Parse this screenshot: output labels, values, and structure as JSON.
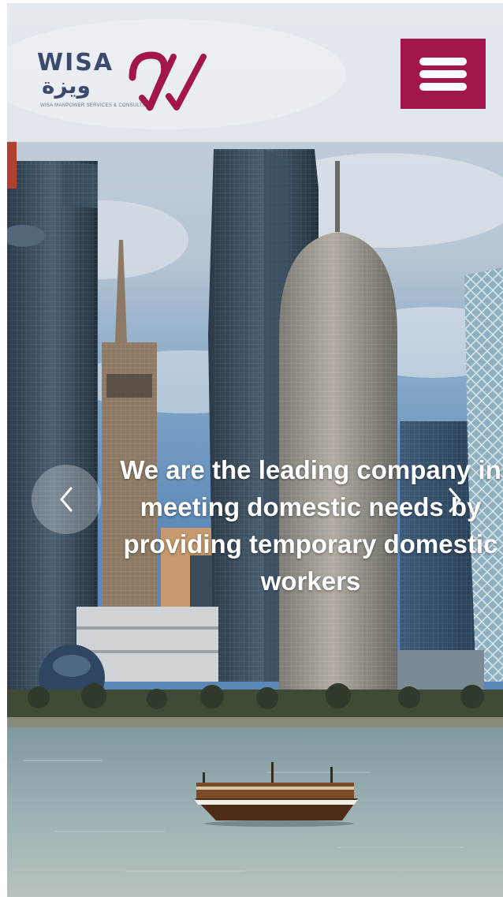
{
  "header": {
    "logo": {
      "wordmark": "WISA",
      "arabic": "ويزة",
      "tagline": "WISA MANPOWER SERVICES & CONSULTING",
      "brand_color": "#a3164b",
      "text_color": "#3c4a6e"
    },
    "menu_button": {
      "icon": "hamburger-icon",
      "color": "#a3164b"
    }
  },
  "hero": {
    "slide_text": "We are the leading company in meeting domestic needs by providing temporary domestic workers",
    "prev_icon": "chevron-left-icon",
    "next_icon": "chevron-right-icon",
    "background": "Doha skyline with traditional dhow boat"
  }
}
